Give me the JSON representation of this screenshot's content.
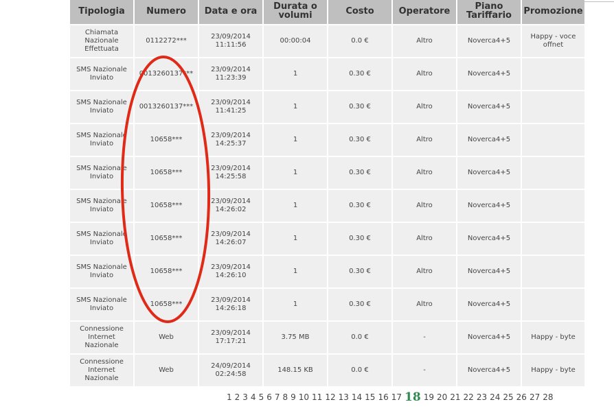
{
  "table": {
    "headers": [
      "Tipologia",
      "Numero",
      "Data e ora",
      "Durata o volumi",
      "Costo",
      "Operatore",
      "Piano Tariffario",
      "Promozione"
    ],
    "rows": [
      [
        "Chiamata Nazionale Effettuata",
        "0112272***",
        "23/09/2014 11:11:56",
        "00:00:04",
        "0.0 €",
        "Altro",
        "Noverca4+5",
        "Happy - voce offnet"
      ],
      [
        "SMS Nazionale Inviato",
        "0013260137***",
        "23/09/2014 11:23:39",
        "1",
        "0.30 €",
        "Altro",
        "Noverca4+5",
        ""
      ],
      [
        "SMS Nazionale Inviato",
        "0013260137***",
        "23/09/2014 11:41:25",
        "1",
        "0.30 €",
        "Altro",
        "Noverca4+5",
        ""
      ],
      [
        "SMS Nazionale Inviato",
        "10658***",
        "23/09/2014 14:25:37",
        "1",
        "0.30 €",
        "Altro",
        "Noverca4+5",
        ""
      ],
      [
        "SMS Nazionale Inviato",
        "10658***",
        "23/09/2014 14:25:58",
        "1",
        "0.30 €",
        "Altro",
        "Noverca4+5",
        ""
      ],
      [
        "SMS Nazionale Inviato",
        "10658***",
        "23/09/2014 14:26:02",
        "1",
        "0.30 €",
        "Altro",
        "Noverca4+5",
        ""
      ],
      [
        "SMS Nazionale Inviato",
        "10658***",
        "23/09/2014 14:26:07",
        "1",
        "0.30 €",
        "Altro",
        "Noverca4+5",
        ""
      ],
      [
        "SMS Nazionale Inviato",
        "10658***",
        "23/09/2014 14:26:10",
        "1",
        "0.30 €",
        "Altro",
        "Noverca4+5",
        ""
      ],
      [
        "SMS Nazionale Inviato",
        "10658***",
        "23/09/2014 14:26:18",
        "1",
        "0.30 €",
        "Altro",
        "Noverca4+5",
        ""
      ],
      [
        "Connessione Internet Nazionale",
        "Web",
        "23/09/2014 17:17:21",
        "3.75 MB",
        "0.0 €",
        "-",
        "Noverca4+5",
        "Happy - byte"
      ],
      [
        "Connessione Internet Nazionale",
        "Web",
        "24/09/2014 02:24:58",
        "148.15 KB",
        "0.0 €",
        "-",
        "Noverca4+5",
        "Happy - byte"
      ]
    ]
  },
  "pagination": {
    "pages": [
      "1",
      "2",
      "3",
      "4",
      "5",
      "6",
      "7",
      "8",
      "9",
      "10",
      "11",
      "12",
      "13",
      "14",
      "15",
      "16",
      "17",
      "18",
      "19",
      "20",
      "21",
      "22",
      "23",
      "24",
      "25",
      "26",
      "27",
      "28"
    ],
    "current": "18",
    "current_color": "#2e8a4d"
  },
  "annotation": {
    "color": "#e02a18",
    "shape": "ellipse"
  }
}
